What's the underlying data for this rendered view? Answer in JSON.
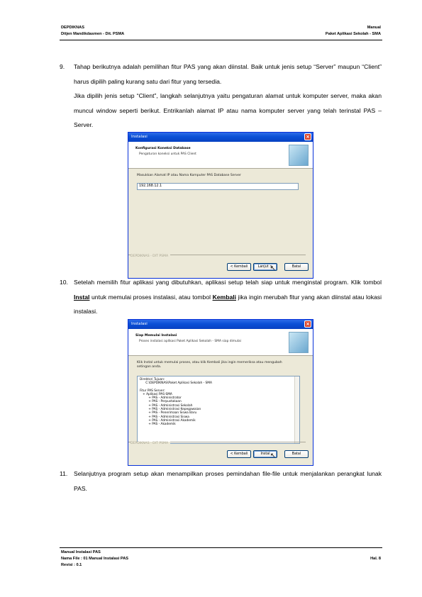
{
  "header": {
    "left_line1": "DEPDIKNAS",
    "left_line2": "Ditjen Mandikdasmen - Dit. PSMA",
    "right_line1": "Manual",
    "right_line2": "Paket Aplikasi Sekolah - SMA"
  },
  "item9": {
    "num": "9.",
    "para1": "Tahap berikutnya adalah pemilihan fitur PAS yang akan diinstal. Baik untuk jenis setup “Server” maupun “Client” harus dipilih paling kurang satu dari fitur yang tersedia.",
    "para2": "Jika dipilih jenis setup “Client”, langkah selanjutnya yaitu pengaturan alamat untuk komputer server, maka akan muncul window seperti berikut. Entrikanlah alamat IP atau nama komputer server yang telah terinstal PAS – Server."
  },
  "dialog1": {
    "title": "Instalasi",
    "heading": "Konfigurasi Koneksi Database",
    "subheading": "Pengaturan koneksi untuk PAS Client",
    "prompt": "Masukkan Alamat IP atau Nama Komputer PAS Database Server",
    "ip_value": "192.168.12.1",
    "brand": "DEPDIKNAS - DIT PSMA",
    "back": "< Kembali",
    "next": "Lanjut >",
    "cancel": "Batal"
  },
  "item10": {
    "num": "10.",
    "pre": "Setelah memilih fitur aplikasi yang dibutuhkan, aplikasi setup telah siap untuk menginstal program. Klik tombol ",
    "instal": "Instal",
    "mid": " untuk memulai proses instalasi, atau tombol ",
    "kembali": "Kembali",
    "post": " jika ingin merubah fitur yang akan diinstal atau lokasi instalasi."
  },
  "dialog2": {
    "title": "Instalasi",
    "heading": "Siap Memulai Instalasi",
    "subheading": "Proses instalasi aplikasi Paket Aplikasi Sekolah - SMA siap dimulai",
    "prompt": "Klik Instal untuk memulai proses, atau klik Kembali jika ingin memeriksa atau mengubah setingan anda.",
    "lines": [
      "Direktori Tujuan:",
      "      C:\\DEPDIKNAS\\Paket Aplikasi Sekolah - SMA",
      "",
      "Fitur PAS Server:",
      "   + Aplikasi PAS-SMA",
      "         + PAS - Administrator",
      "         + PAS - Perpustakaan",
      "         + PAS - Administrasi Sekolah",
      "         + PAS - Administrasi Kepegawaian",
      "         + PAS - Penerimaan Siswa Baru",
      "         + PAS - Administrasi Siswa",
      "         + PAS - Administrasi Akademik",
      "         + PAS - Akademik"
    ],
    "brand": "DEPDIKNAS - DIT PSMA",
    "back": "< Kembali",
    "next": "Instal",
    "cancel": "Batal"
  },
  "item11": {
    "num": "11.",
    "text": "Selanjutnya program setup akan menampilkan proses pemindahan file-file untuk menjalankan perangkat lunak PAS."
  },
  "footer": {
    "line1": "Manual Instalasi PAS",
    "line2": "Nama File : 01 Manual Instalasi PAS",
    "line3": "Revisi : 0.1",
    "page": "Hal. 8"
  },
  "colors": {
    "titlebar": "#0a4fd6",
    "dialog_bg": "#ece9d8"
  }
}
